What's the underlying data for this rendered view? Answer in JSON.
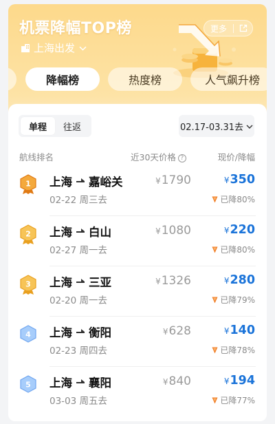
{
  "header": {
    "title": "机票降幅TOP榜",
    "origin": "上海出发",
    "more_label": "更多"
  },
  "tabs": [
    {
      "label": "降幅榜",
      "active": true
    },
    {
      "label": "热度榜",
      "active": false
    },
    {
      "label": "人气飙升榜",
      "active": false
    }
  ],
  "trip_type": [
    {
      "label": "单程",
      "active": true
    },
    {
      "label": "往返",
      "active": false
    }
  ],
  "date_range": "02.17-03.31去",
  "columns": {
    "route": "航线排名",
    "history": "近30天价格",
    "current": "现价/降幅"
  },
  "colors": {
    "accent_blue": "#1a73d9",
    "gold": "#f2a623",
    "drop_orange": "#f07a21",
    "rank_blue": "#7fb3f5"
  },
  "rows": [
    {
      "rank": "1",
      "origin": "上海",
      "dest": "嘉峪关",
      "date": "02-22 周三去",
      "old_price": "1790",
      "new_price": "350",
      "drop": "已降80%"
    },
    {
      "rank": "2",
      "origin": "上海",
      "dest": "白山",
      "date": "02-27 周一去",
      "old_price": "1080",
      "new_price": "220",
      "drop": "已降80%"
    },
    {
      "rank": "3",
      "origin": "上海",
      "dest": "三亚",
      "date": "02-20 周一去",
      "old_price": "1326",
      "new_price": "280",
      "drop": "已降79%"
    },
    {
      "rank": "4",
      "origin": "上海",
      "dest": "衡阳",
      "date": "02-23 周四去",
      "old_price": "628",
      "new_price": "140",
      "drop": "已降78%"
    },
    {
      "rank": "5",
      "origin": "上海",
      "dest": "襄阳",
      "date": "03-03 周五去",
      "old_price": "840",
      "new_price": "194",
      "drop": "已降77%"
    }
  ],
  "currency": "¥"
}
